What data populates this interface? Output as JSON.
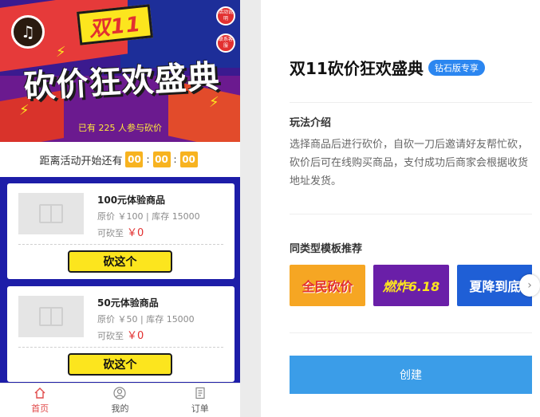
{
  "preview": {
    "banner": {
      "badge": "双11",
      "title": "砍价狂欢盛典",
      "participants_prefix": "已有",
      "participants_count": "225",
      "participants_suffix": "人参与砍价",
      "side_buttons": [
        "活动说明",
        "联系客服"
      ]
    },
    "countdown": {
      "label": "距离活动开始还有",
      "values": [
        "00",
        "00",
        "00"
      ]
    },
    "products": [
      {
        "name": "100元体验商品",
        "meta": "原价 ￥100 | 库存 15000",
        "cut_label": "可砍至",
        "cut_price": "￥0",
        "button": "砍这个"
      },
      {
        "name": "50元体验商品",
        "meta": "原价 ￥50 | 库存 15000",
        "cut_label": "可砍至",
        "cut_price": "￥0",
        "button": "砍这个"
      }
    ],
    "tabbar": [
      {
        "label": "首页",
        "icon": "home-icon"
      },
      {
        "label": "我的",
        "icon": "user-icon"
      },
      {
        "label": "订单",
        "icon": "order-icon"
      }
    ]
  },
  "panel": {
    "title": "双11砍价狂欢盛典",
    "badge": "钻石版专享",
    "intro_heading": "玩法介绍",
    "intro_text": "选择商品后进行砍价，自砍一刀后邀请好友帮忙砍，砍价后可在线购买商品，支付成功后商家会根据收货地址发货。",
    "similar_heading": "同类型模板推荐",
    "templates": [
      {
        "text": "全民砍价"
      },
      {
        "text": "燃炸6.18"
      },
      {
        "text": "夏降到底"
      }
    ],
    "create_button": "创建"
  },
  "colors": {
    "accent": "#3b9de8",
    "badge": "#2b86f0",
    "price": "#e23030",
    "countdown": "#f7b320",
    "button_yellow": "#fce51e",
    "list_bg": "#1d1da8"
  }
}
